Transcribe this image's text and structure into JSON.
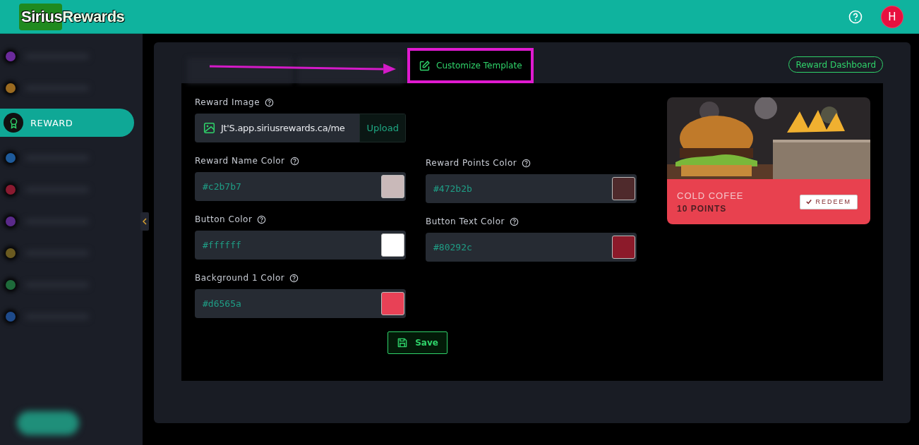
{
  "header": {
    "logo": {
      "part1": "Sirius",
      "part2": "Rewards"
    },
    "avatar": "H"
  },
  "sidebar": {
    "items": [
      {
        "kind": "blurred",
        "color": "#6a2a9a",
        "selected": false
      },
      {
        "kind": "blurred",
        "color": "#9a6a20",
        "selected": false
      },
      {
        "kind": "labeled",
        "label": "REWARD",
        "selected": true
      },
      {
        "kind": "blurred",
        "color": "#1e5a9a",
        "selected": false
      },
      {
        "kind": "blurred",
        "color": "#8a1a30",
        "selected": false
      },
      {
        "kind": "blurred",
        "color": "#5a2a8a",
        "selected": false
      },
      {
        "kind": "blurred",
        "color": "#6a5a20",
        "selected": false
      },
      {
        "kind": "blurred",
        "color": "#1e6a3a",
        "selected": false
      },
      {
        "kind": "blurred",
        "color": "#1e4a8a",
        "selected": false
      }
    ]
  },
  "tabs": [
    {
      "kind": "blurred",
      "selected": false
    },
    {
      "kind": "blurred",
      "selected": false
    },
    {
      "kind": "labeled",
      "label": "Customize Template",
      "selected": true
    }
  ],
  "dashboard_button": "Reward Dashboard",
  "form": {
    "image": {
      "label": "Reward Image",
      "value": "Jt'S.app.siriusrewards.ca/me",
      "button": "Upload"
    },
    "left": [
      {
        "label": "Reward Name Color",
        "value": "#c2b7b7",
        "color": "#c9b9b9"
      },
      {
        "label": "Button Color",
        "value": "#ffffff",
        "color": "#ffffff"
      },
      {
        "label": "Background 1 Color",
        "value": "#d6565a",
        "color": "#e84156"
      }
    ],
    "right": [
      {
        "label": "Reward Points Color",
        "value": "#472b2b",
        "color": "#4f2a2c"
      },
      {
        "label": "Button Text Color",
        "value": "#80292c",
        "color": "#8c1a2a"
      }
    ],
    "save": "Save"
  },
  "preview": {
    "name": "COLD COFEE",
    "points": "10 POINTS",
    "button": "REDEEM"
  }
}
